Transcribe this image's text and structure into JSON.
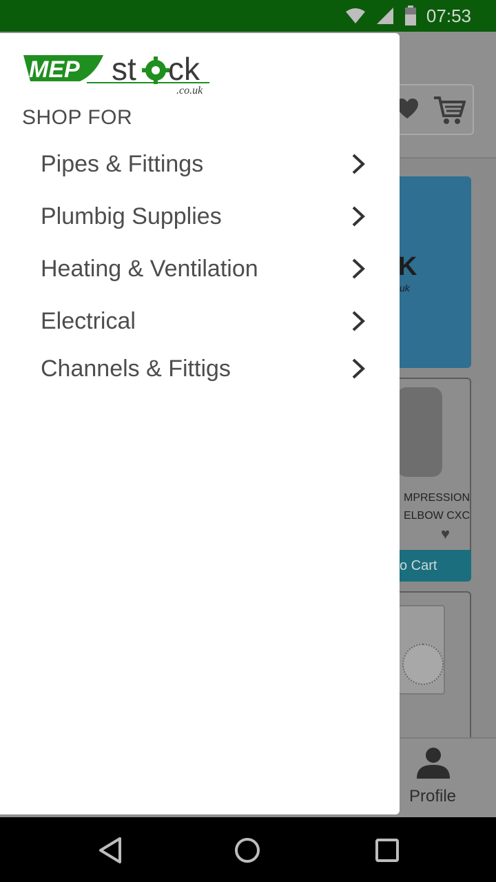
{
  "status_bar": {
    "time": "07:53",
    "icons": [
      "wifi-icon",
      "signal-icon",
      "battery-icon"
    ]
  },
  "background_app": {
    "banner_text": "K",
    "banner_sub": "uk",
    "product_name": "MPRESSION ELBOW CXC",
    "add_to_cart_label": "o Cart",
    "profile_label": "Profile"
  },
  "drawer": {
    "logo": {
      "text": "MEPstock",
      "suffix": ".co.uk"
    },
    "section_title": "SHOP FOR",
    "categories": [
      {
        "label": "Pipes & Fittings"
      },
      {
        "label": "Plumbig Supplies"
      },
      {
        "label": "Heating & Ventilation"
      },
      {
        "label": "Electrical"
      },
      {
        "label": "Channels & Fittigs"
      }
    ]
  },
  "nav_bar": {
    "buttons": [
      "back-icon",
      "home-icon",
      "recents-icon"
    ]
  },
  "colors": {
    "status_bar": "#0a5c0a",
    "brand_green": "#1f8f1f",
    "text_dark": "#4d4d4d",
    "dim_overlay": "#8a8a8a"
  }
}
